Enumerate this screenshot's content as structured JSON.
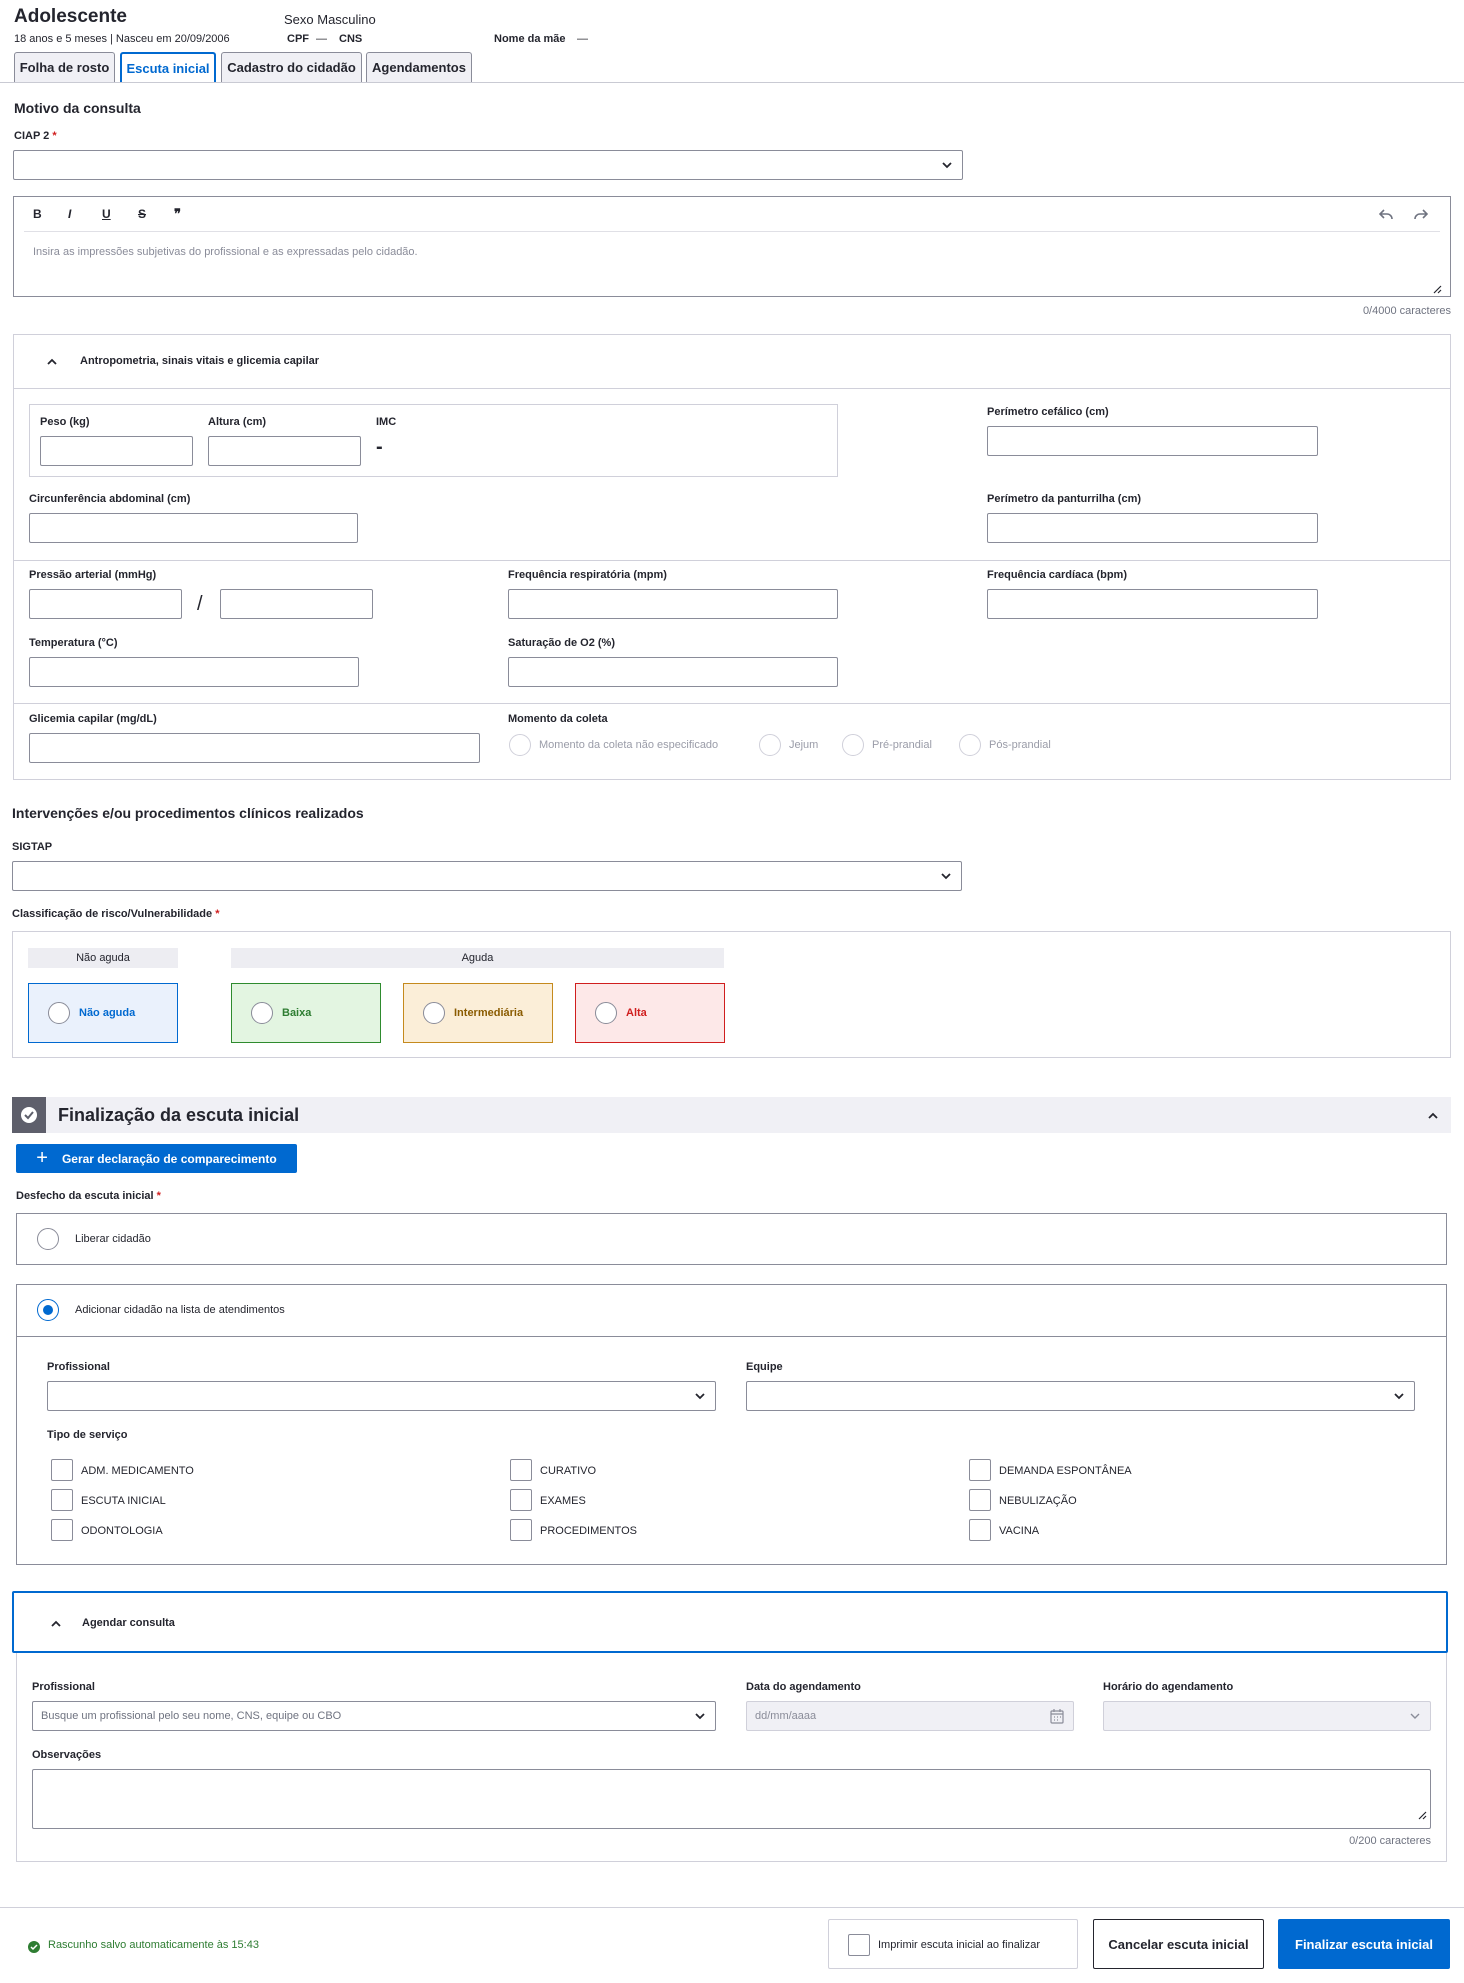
{
  "patient": {
    "name": "Adolescente",
    "age_birth": "18 anos e 5 meses | Nasceu em 20/09/2006",
    "sex": "Sexo Masculino",
    "cpf_label": "CPF",
    "cpf_value": "—",
    "cns_label": "CNS",
    "mother_label": "Nome da mãe",
    "mother_value": "—"
  },
  "tabs": [
    "Folha de rosto",
    "Escuta inicial",
    "Cadastro do cidadão",
    "Agendamentos"
  ],
  "motivo": {
    "title": "Motivo da consulta",
    "ciap_label": "CIAP 2",
    "required_mark": "*",
    "editor_placeholder": "Insira as impressões subjetivas do profissional e as expressadas pelo cidadão.",
    "char_count": "0/4000 caracteres",
    "toolbar": [
      "B",
      "I",
      "U",
      "S",
      "❞"
    ]
  },
  "antropometria": {
    "title": "Antropometria, sinais vitais e glicemia capilar",
    "peso": "Peso (kg)",
    "altura": "Altura (cm)",
    "imc": "IMC",
    "imc_value": "-",
    "perimetro_cefalico": "Perímetro cefálico (cm)",
    "circ_abdominal": "Circunferência abdominal (cm)",
    "perimetro_panturrilha": "Perímetro da panturrilha (cm)",
    "pressao": "Pressão arterial (mmHg)",
    "pressao_sep": "/",
    "freq_resp": "Frequência respiratória (mpm)",
    "freq_card": "Frequência cardíaca (bpm)",
    "temperatura": "Temperatura (°C)",
    "saturacao": "Saturação de O2 (%)",
    "glicemia": "Glicemia capilar (mg/dL)",
    "momento": "Momento da coleta",
    "momento_options": [
      "Momento da coleta não especificado",
      "Jejum",
      "Pré-prandial",
      "Pós-prandial"
    ]
  },
  "intervencoes": {
    "title": "Intervenções e/ou procedimentos clínicos realizados",
    "sigtap": "SIGTAP",
    "risco_label": "Classificação de risco/Vulnerabilidade",
    "nao_aguda_header": "Não aguda",
    "aguda_header": "Aguda",
    "options": [
      "Não aguda",
      "Baixa",
      "Intermediária",
      "Alta"
    ]
  },
  "finalizacao": {
    "title": "Finalização da escuta inicial",
    "gerar_btn": "Gerar declaração de comparecimento",
    "desfecho_label": "Desfecho da escuta inicial",
    "liberar": "Liberar cidadão",
    "adicionar": "Adicionar cidadão na lista de atendimentos",
    "profissional": "Profissional",
    "equipe": "Equipe",
    "tipo_servico": "Tipo de serviço",
    "servicos": [
      "ADM. MEDICAMENTO",
      "CURATIVO",
      "DEMANDA ESPONTÂNEA",
      "ESCUTA INICIAL",
      "EXAMES",
      "NEBULIZAÇÃO",
      "ODONTOLOGIA",
      "PROCEDIMENTOS",
      "VACINA"
    ]
  },
  "agendar": {
    "title": "Agendar consulta",
    "profissional": "Profissional",
    "profissional_placeholder": "Busque um profissional pelo seu nome, CNS, equipe ou CBO",
    "data": "Data do agendamento",
    "data_placeholder": "dd/mm/aaaa",
    "horario": "Horário do agendamento",
    "observacoes": "Observações",
    "char_count": "0/200 caracteres"
  },
  "footer": {
    "saved": "Rascunho salvo automaticamente às 15:43",
    "imprimir": "Imprimir escuta inicial ao finalizar",
    "cancelar": "Cancelar escuta inicial",
    "finalizar": "Finalizar escuta inicial"
  },
  "colors": {
    "primary": "#0069d0",
    "success": "#2e7d32",
    "danger": "#d01e1e",
    "baixa_bg": "#e3f5e1",
    "baixa_border": "#2e8b2e",
    "inter_bg": "#fbeed8",
    "inter_border": "#c58a1d",
    "alta_bg": "#fde8e8",
    "alta_border": "#d01e1e",
    "nao_aguda_bg": "#eaf1fc"
  }
}
